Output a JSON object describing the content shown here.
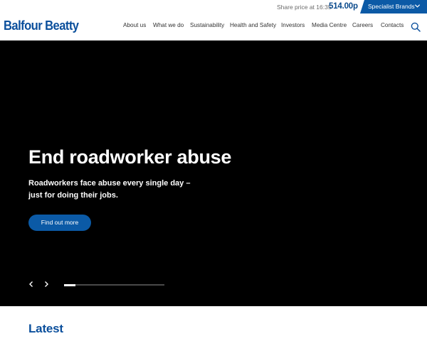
{
  "topbar": {
    "share_label": "Share price at 16:35",
    "share_value": "514.00p",
    "brands_label": "Specialist Brands",
    "brands_icon": "chevron-down-icon"
  },
  "header": {
    "logo_text": "Balfour Beatty",
    "nav": [
      {
        "label": "About us"
      },
      {
        "label": "What we do"
      },
      {
        "label": "Sustainability"
      },
      {
        "label": "Health and Safety"
      },
      {
        "label": "Investors"
      },
      {
        "label": "Media Centre"
      },
      {
        "label": "Careers"
      },
      {
        "label": "Contacts"
      }
    ],
    "search_icon": "search-icon"
  },
  "hero": {
    "title": "End roadworker abuse",
    "subtitle_line1": "Roadworkers face abuse every single day –",
    "subtitle_line2": "just for doing their jobs.",
    "cta_label": "Find out more",
    "slider_progress": 0.11,
    "prev_icon": "chevron-left-icon",
    "next_icon": "chevron-right-icon"
  },
  "latest": {
    "heading": "Latest"
  },
  "colors": {
    "brand_blue": "#0b4f9c",
    "accent_blue": "#0b5aa6",
    "hero_bg": "#000000"
  }
}
